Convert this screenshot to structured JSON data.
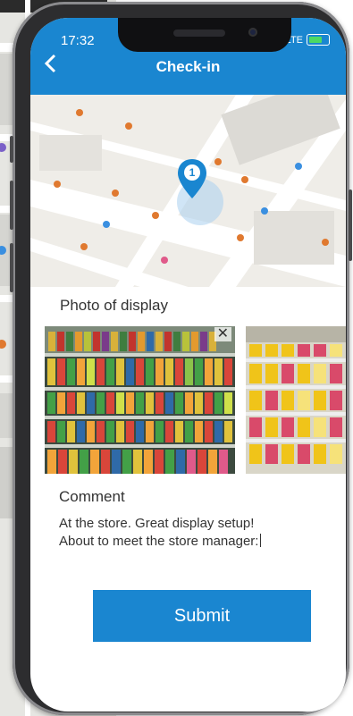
{
  "status": {
    "time": "17:32",
    "network": "LTE"
  },
  "header": {
    "title": "Check-in",
    "back_icon": "chevron-left-icon"
  },
  "map": {
    "pin_number": "1",
    "pin_color": "#1a86d0"
  },
  "photos": {
    "label": "Photo of display",
    "remove_icon": "close-icon"
  },
  "comment": {
    "label": "Comment",
    "line1": "At the store. Great display setup!",
    "line2": "About to meet the store manager:"
  },
  "submit_label": "Submit",
  "colors": {
    "accent": "#1a86d0"
  }
}
